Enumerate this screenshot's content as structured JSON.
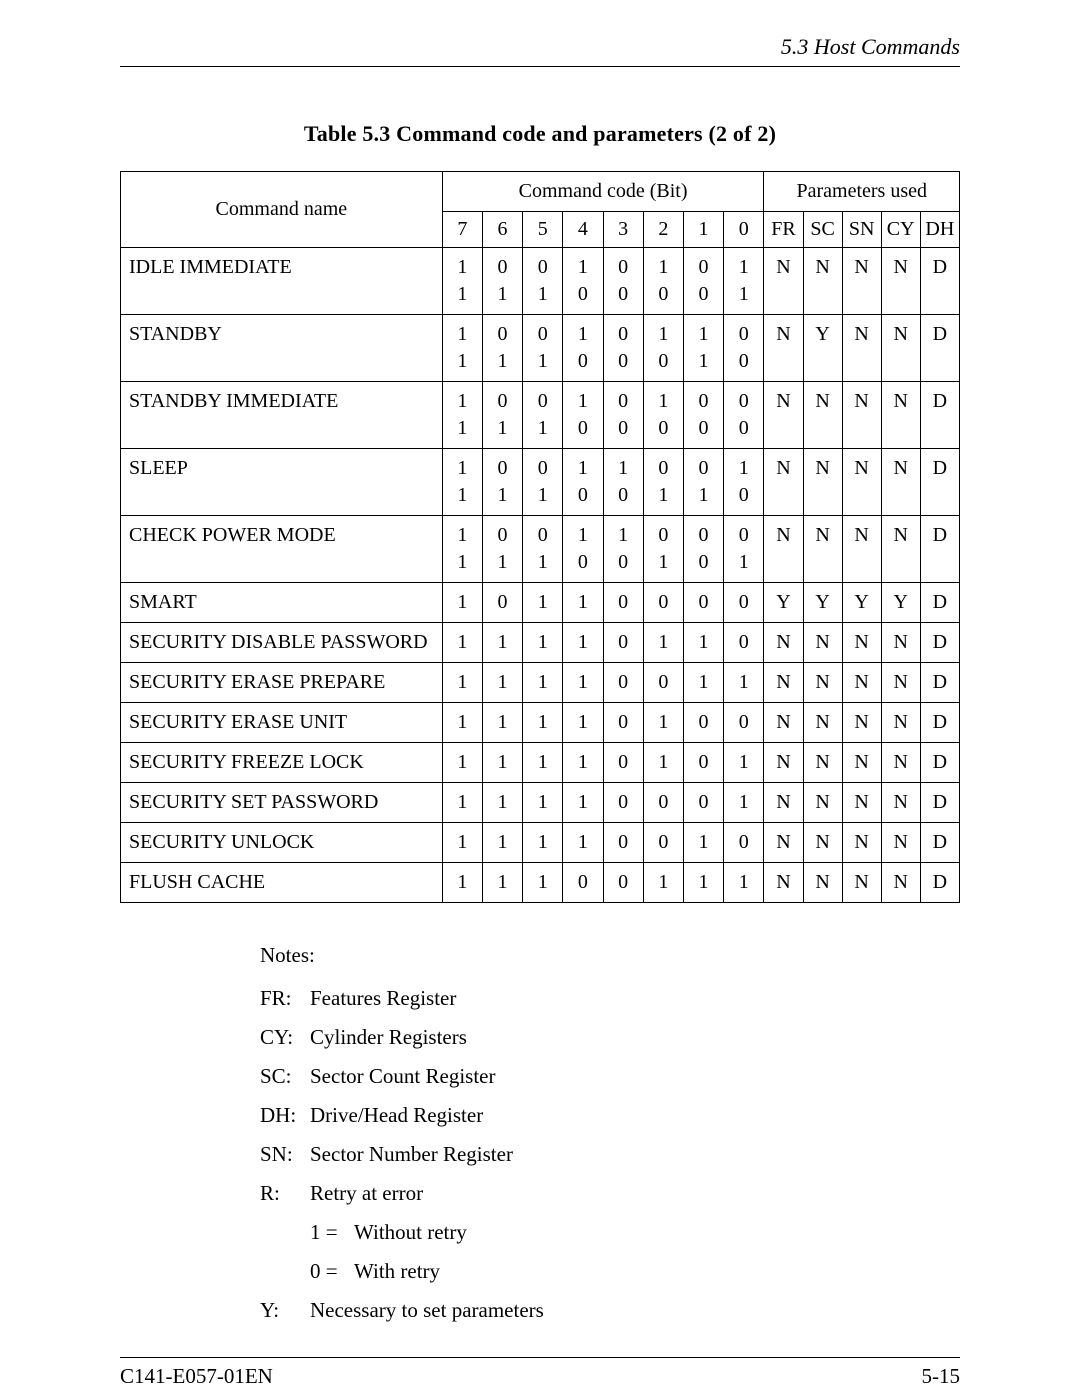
{
  "header": {
    "section": "5.3  Host Commands"
  },
  "table": {
    "caption": "Table 5.3   Command code and parameters (2 of 2)",
    "headers": {
      "command_name": "Command name",
      "code_group": "Command code (Bit)",
      "param_group": "Parameters used",
      "bits": [
        "7",
        "6",
        "5",
        "4",
        "3",
        "2",
        "1",
        "0"
      ],
      "params": [
        "FR",
        "SC",
        "SN",
        "CY",
        "DH"
      ]
    },
    "rows": [
      {
        "name": "IDLE IMMEDIATE",
        "bits": [
          [
            "1",
            "1"
          ],
          [
            "0",
            "1"
          ],
          [
            "0",
            "1"
          ],
          [
            "1",
            "0"
          ],
          [
            "0",
            "0"
          ],
          [
            "1",
            "0"
          ],
          [
            "0",
            "0"
          ],
          [
            "1",
            "1"
          ]
        ],
        "params": [
          "N",
          "N",
          "N",
          "N",
          "D"
        ]
      },
      {
        "name": "STANDBY",
        "bits": [
          [
            "1",
            "1"
          ],
          [
            "0",
            "1"
          ],
          [
            "0",
            "1"
          ],
          [
            "1",
            "0"
          ],
          [
            "0",
            "0"
          ],
          [
            "1",
            "0"
          ],
          [
            "1",
            "1"
          ],
          [
            "0",
            "0"
          ]
        ],
        "params": [
          "N",
          "Y",
          "N",
          "N",
          "D"
        ]
      },
      {
        "name": "STANDBY IMMEDIATE",
        "bits": [
          [
            "1",
            "1"
          ],
          [
            "0",
            "1"
          ],
          [
            "0",
            "1"
          ],
          [
            "1",
            "0"
          ],
          [
            "0",
            "0"
          ],
          [
            "1",
            "0"
          ],
          [
            "0",
            "0"
          ],
          [
            "0",
            "0"
          ]
        ],
        "params": [
          "N",
          "N",
          "N",
          "N",
          "D"
        ]
      },
      {
        "name": "SLEEP",
        "bits": [
          [
            "1",
            "1"
          ],
          [
            "0",
            "1"
          ],
          [
            "0",
            "1"
          ],
          [
            "1",
            "0"
          ],
          [
            "1",
            "0"
          ],
          [
            "0",
            "1"
          ],
          [
            "0",
            "1"
          ],
          [
            "1",
            "0"
          ]
        ],
        "params": [
          "N",
          "N",
          "N",
          "N",
          "D"
        ]
      },
      {
        "name": "CHECK POWER MODE",
        "bits": [
          [
            "1",
            "1"
          ],
          [
            "0",
            "1"
          ],
          [
            "0",
            "1"
          ],
          [
            "1",
            "0"
          ],
          [
            "1",
            "0"
          ],
          [
            "0",
            "1"
          ],
          [
            "0",
            "0"
          ],
          [
            "0",
            "1"
          ]
        ],
        "params": [
          "N",
          "N",
          "N",
          "N",
          "D"
        ]
      },
      {
        "name": "SMART",
        "bits": [
          [
            "1"
          ],
          [
            "0"
          ],
          [
            "1"
          ],
          [
            "1"
          ],
          [
            "0"
          ],
          [
            "0"
          ],
          [
            "0"
          ],
          [
            "0"
          ]
        ],
        "params": [
          "Y",
          "Y",
          "Y",
          "Y",
          "D"
        ]
      },
      {
        "name": "SECURITY DISABLE PASSWORD",
        "bits": [
          [
            "1"
          ],
          [
            "1"
          ],
          [
            "1"
          ],
          [
            "1"
          ],
          [
            "0"
          ],
          [
            "1"
          ],
          [
            "1"
          ],
          [
            "0"
          ]
        ],
        "params": [
          "N",
          "N",
          "N",
          "N",
          "D"
        ]
      },
      {
        "name": "SECURITY ERASE PREPARE",
        "bits": [
          [
            "1"
          ],
          [
            "1"
          ],
          [
            "1"
          ],
          [
            "1"
          ],
          [
            "0"
          ],
          [
            "0"
          ],
          [
            "1"
          ],
          [
            "1"
          ]
        ],
        "params": [
          "N",
          "N",
          "N",
          "N",
          "D"
        ]
      },
      {
        "name": "SECURITY ERASE UNIT",
        "bits": [
          [
            "1"
          ],
          [
            "1"
          ],
          [
            "1"
          ],
          [
            "1"
          ],
          [
            "0"
          ],
          [
            "1"
          ],
          [
            "0"
          ],
          [
            "0"
          ]
        ],
        "params": [
          "N",
          "N",
          "N",
          "N",
          "D"
        ]
      },
      {
        "name": "SECURITY FREEZE LOCK",
        "bits": [
          [
            "1"
          ],
          [
            "1"
          ],
          [
            "1"
          ],
          [
            "1"
          ],
          [
            "0"
          ],
          [
            "1"
          ],
          [
            "0"
          ],
          [
            "1"
          ]
        ],
        "params": [
          "N",
          "N",
          "N",
          "N",
          "D"
        ]
      },
      {
        "name": "SECURITY SET PASSWORD",
        "bits": [
          [
            "1"
          ],
          [
            "1"
          ],
          [
            "1"
          ],
          [
            "1"
          ],
          [
            "0"
          ],
          [
            "0"
          ],
          [
            "0"
          ],
          [
            "1"
          ]
        ],
        "params": [
          "N",
          "N",
          "N",
          "N",
          "D"
        ]
      },
      {
        "name": "SECURITY UNLOCK",
        "bits": [
          [
            "1"
          ],
          [
            "1"
          ],
          [
            "1"
          ],
          [
            "1"
          ],
          [
            "0"
          ],
          [
            "0"
          ],
          [
            "1"
          ],
          [
            "0"
          ]
        ],
        "params": [
          "N",
          "N",
          "N",
          "N",
          "D"
        ]
      },
      {
        "name": "FLUSH CACHE",
        "bits": [
          [
            "1"
          ],
          [
            "1"
          ],
          [
            "1"
          ],
          [
            "0"
          ],
          [
            "0"
          ],
          [
            "1"
          ],
          [
            "1"
          ],
          [
            "1"
          ]
        ],
        "params": [
          "N",
          "N",
          "N",
          "N",
          "D"
        ]
      }
    ]
  },
  "notes": {
    "label": "Notes:",
    "items": [
      {
        "key": "FR:",
        "val": "Features Register"
      },
      {
        "key": "CY:",
        "val": "Cylinder Registers"
      },
      {
        "key": "SC:",
        "val": "Sector Count Register"
      },
      {
        "key": "DH:",
        "val": "Drive/Head Register"
      },
      {
        "key": "SN:",
        "val": "Sector Number Register"
      },
      {
        "key": "R:",
        "val": "Retry at error"
      }
    ],
    "retry_sub": [
      {
        "eq": "1 =",
        "val": "Without retry"
      },
      {
        "eq": "0 =",
        "val": "With retry"
      }
    ],
    "last": {
      "key": "Y:",
      "val": "Necessary to set parameters"
    }
  },
  "footer": {
    "left": "C141-E057-01EN",
    "right": "5-15"
  }
}
